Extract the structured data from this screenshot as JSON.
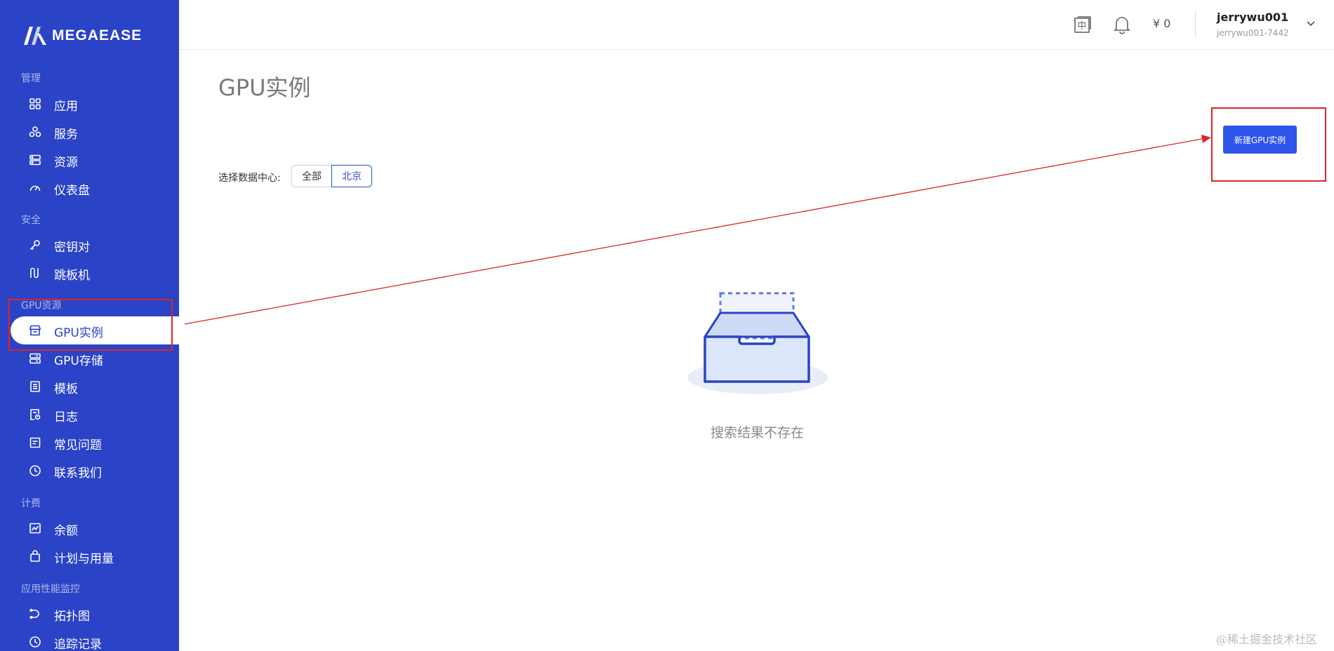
{
  "brand": {
    "name": "MEGAEASE"
  },
  "sidebar": {
    "sections": [
      {
        "label": "管理",
        "items": [
          {
            "label": "应用",
            "icon": "grid-icon"
          },
          {
            "label": "服务",
            "icon": "cube-icon"
          },
          {
            "label": "资源",
            "icon": "server-icon"
          },
          {
            "label": "仪表盘",
            "icon": "dashboard-icon"
          }
        ]
      },
      {
        "label": "安全",
        "items": [
          {
            "label": "密钥对",
            "icon": "key-icon"
          },
          {
            "label": "跳板机",
            "icon": "jump-host-icon"
          }
        ]
      },
      {
        "label": "GPU资源",
        "items": [
          {
            "label": "GPU实例",
            "icon": "store-icon",
            "active": true
          },
          {
            "label": "GPU存储",
            "icon": "storage-icon"
          },
          {
            "label": "模板",
            "icon": "template-icon"
          },
          {
            "label": "日志",
            "icon": "log-icon"
          },
          {
            "label": "常见问题",
            "icon": "faq-icon"
          },
          {
            "label": "联系我们",
            "icon": "clock-icon"
          }
        ]
      },
      {
        "label": "计费",
        "items": [
          {
            "label": "余额",
            "icon": "chart-line-icon"
          },
          {
            "label": "计划与用量",
            "icon": "bag-icon"
          }
        ]
      },
      {
        "label": "应用性能监控",
        "items": [
          {
            "label": "拓扑图",
            "icon": "topology-icon"
          },
          {
            "label": "追踪记录",
            "icon": "clock-icon"
          }
        ]
      }
    ]
  },
  "header": {
    "language_icon": "language-icon",
    "language_glyph": "中",
    "bell_icon": "bell-icon",
    "balance": "¥ 0",
    "user": {
      "name": "jerrywu001",
      "id": "jerrywu001-7442"
    }
  },
  "main": {
    "title": "GPU实例",
    "datacenter_label": "选择数据中心:",
    "datacenter_options": [
      "全部",
      "北京"
    ],
    "datacenter_selected": "北京",
    "new_button": "新建GPU实例",
    "empty_text": "搜索结果不存在"
  },
  "watermark": "@稀土掘金技术社区",
  "colors": {
    "sidebar": "#2a43c7",
    "primary": "#2f54eb",
    "annotation": "#d9262a"
  }
}
